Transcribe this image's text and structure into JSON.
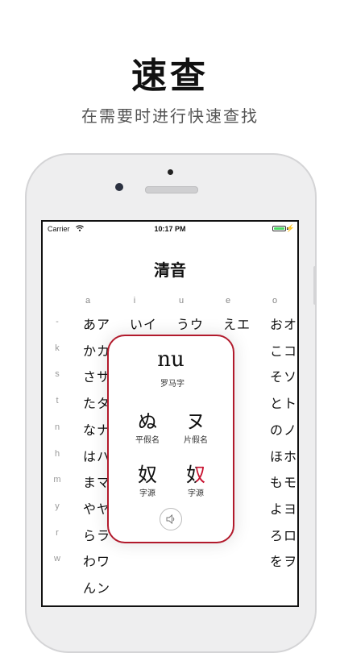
{
  "promo": {
    "title": "速查",
    "subtitle": "在需要时进行快速查找"
  },
  "status_bar": {
    "carrier": "Carrier",
    "time": "10:17 PM",
    "battery_color": "#4cd964"
  },
  "screen": {
    "title": "清音",
    "vowels": [
      "a",
      "i",
      "u",
      "e",
      "o"
    ],
    "rows": [
      {
        "label": "-",
        "cells": [
          "あア",
          "いイ",
          "うウ",
          "えエ",
          "おオ"
        ]
      },
      {
        "label": "k",
        "cells": [
          "かカ",
          "",
          "",
          "",
          "こコ"
        ]
      },
      {
        "label": "s",
        "cells": [
          "さサ",
          "",
          "",
          "",
          "そソ"
        ]
      },
      {
        "label": "t",
        "cells": [
          "たタ",
          "",
          "",
          "",
          "とト"
        ]
      },
      {
        "label": "n",
        "cells": [
          "なナ",
          "",
          "",
          "",
          "のノ"
        ]
      },
      {
        "label": "h",
        "cells": [
          "はハ",
          "",
          "",
          "",
          "ほホ"
        ]
      },
      {
        "label": "m",
        "cells": [
          "まマ",
          "",
          "",
          "",
          "もモ"
        ]
      },
      {
        "label": "y",
        "cells": [
          "やヤ",
          "",
          "",
          "",
          "よヨ"
        ]
      },
      {
        "label": "r",
        "cells": [
          "らラ",
          "",
          "",
          "",
          "ろロ"
        ]
      },
      {
        "label": "w",
        "cells": [
          "わワ",
          "",
          "",
          "",
          "をヲ"
        ]
      },
      {
        "label": "",
        "cells": [
          "んン",
          "",
          "",
          "",
          ""
        ]
      }
    ]
  },
  "popup": {
    "romaji": "nu",
    "romaji_label": "罗马字",
    "hiragana": "ぬ",
    "hiragana_label": "平假名",
    "katakana": "ヌ",
    "katakana_label": "片假名",
    "hira_origin": "奴",
    "hira_origin_label": "字源",
    "kata_origin": "奴",
    "kata_origin_label": "字源",
    "border_color": "#b21a2c",
    "speaker_icon": "speaker-icon"
  }
}
